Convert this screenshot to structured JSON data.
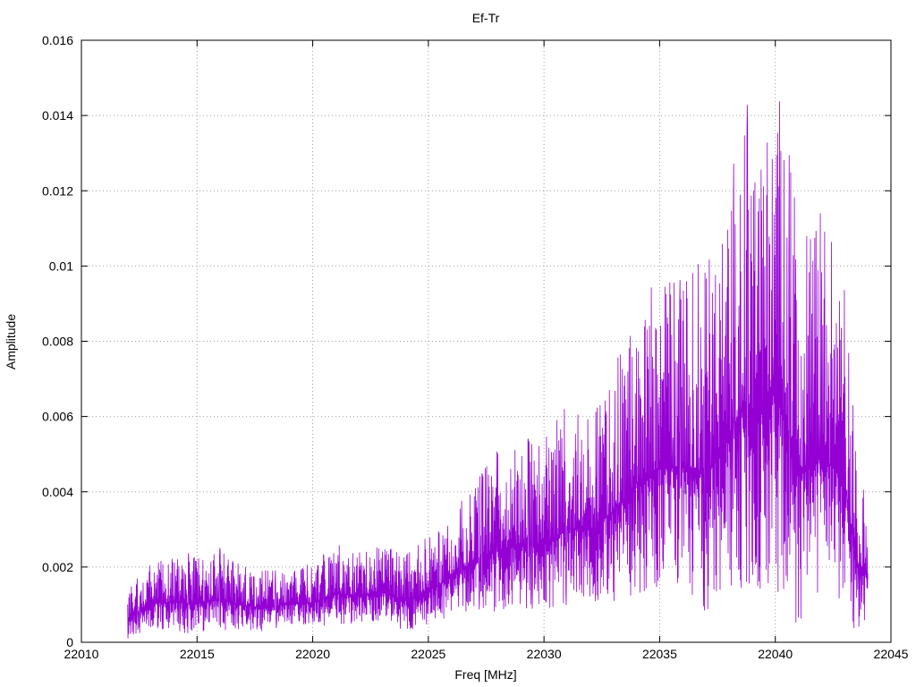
{
  "chart_data": {
    "type": "line",
    "title": "Ef-Tr",
    "xlabel": "Freq [MHz]",
    "ylabel": "Amplitude",
    "xlim": [
      22010,
      22045
    ],
    "ylim": [
      0,
      0.016
    ],
    "x_ticks": [
      22010,
      22015,
      22020,
      22025,
      22030,
      22035,
      22040,
      22045
    ],
    "x_tick_labels": [
      "22010",
      "22015",
      "22020",
      "22025",
      "22030",
      "22035",
      "22040",
      "22045"
    ],
    "y_ticks": [
      0,
      0.002,
      0.004,
      0.006,
      0.008,
      0.01,
      0.012,
      0.014,
      0.016
    ],
    "y_tick_labels": [
      "0",
      "0.002",
      "0.004",
      "0.006",
      "0.008",
      "0.01",
      "0.012",
      "0.014",
      "0.016"
    ],
    "grid": true,
    "series": [
      {
        "color": "#9400d3",
        "envelope": {
          "x": [
            22012.0,
            22013.0,
            22014.0,
            22015.0,
            22016.0,
            22017.0,
            22018.0,
            22019.0,
            22020.0,
            22021.0,
            22022.0,
            22023.0,
            22024.0,
            22025.0,
            22026.0,
            22027.0,
            22028.0,
            22029.0,
            22030.0,
            22031.0,
            22032.0,
            22033.0,
            22034.0,
            22035.0,
            22036.0,
            22037.0,
            22038.0,
            22038.7,
            22039.0,
            22040.0,
            22041.0,
            22042.0,
            22043.0,
            22043.5,
            22044.0
          ],
          "max": [
            0.0014,
            0.0021,
            0.0023,
            0.0024,
            0.0025,
            0.0021,
            0.0019,
            0.0019,
            0.0021,
            0.0026,
            0.0024,
            0.0026,
            0.0024,
            0.0028,
            0.0034,
            0.0042,
            0.0051,
            0.0054,
            0.0054,
            0.0063,
            0.0061,
            0.0073,
            0.009,
            0.0098,
            0.0096,
            0.0105,
            0.0118,
            0.015,
            0.0125,
            0.0154,
            0.0113,
            0.0114,
            0.0097,
            0.0052,
            0.0035
          ],
          "min": [
            0.0001,
            0.0004,
            0.0003,
            0.0002,
            0.0003,
            0.0003,
            0.0003,
            0.0005,
            0.0004,
            0.0005,
            0.0005,
            0.0006,
            0.0003,
            0.0005,
            0.0007,
            0.0009,
            0.0008,
            0.0009,
            0.0009,
            0.001,
            0.0011,
            0.0011,
            0.0013,
            0.0015,
            0.0016,
            0.0008,
            0.0015,
            0.0012,
            0.0014,
            0.0015,
            0.0002,
            0.001,
            0.001,
            0.0002,
            0.0007
          ]
        }
      }
    ]
  }
}
